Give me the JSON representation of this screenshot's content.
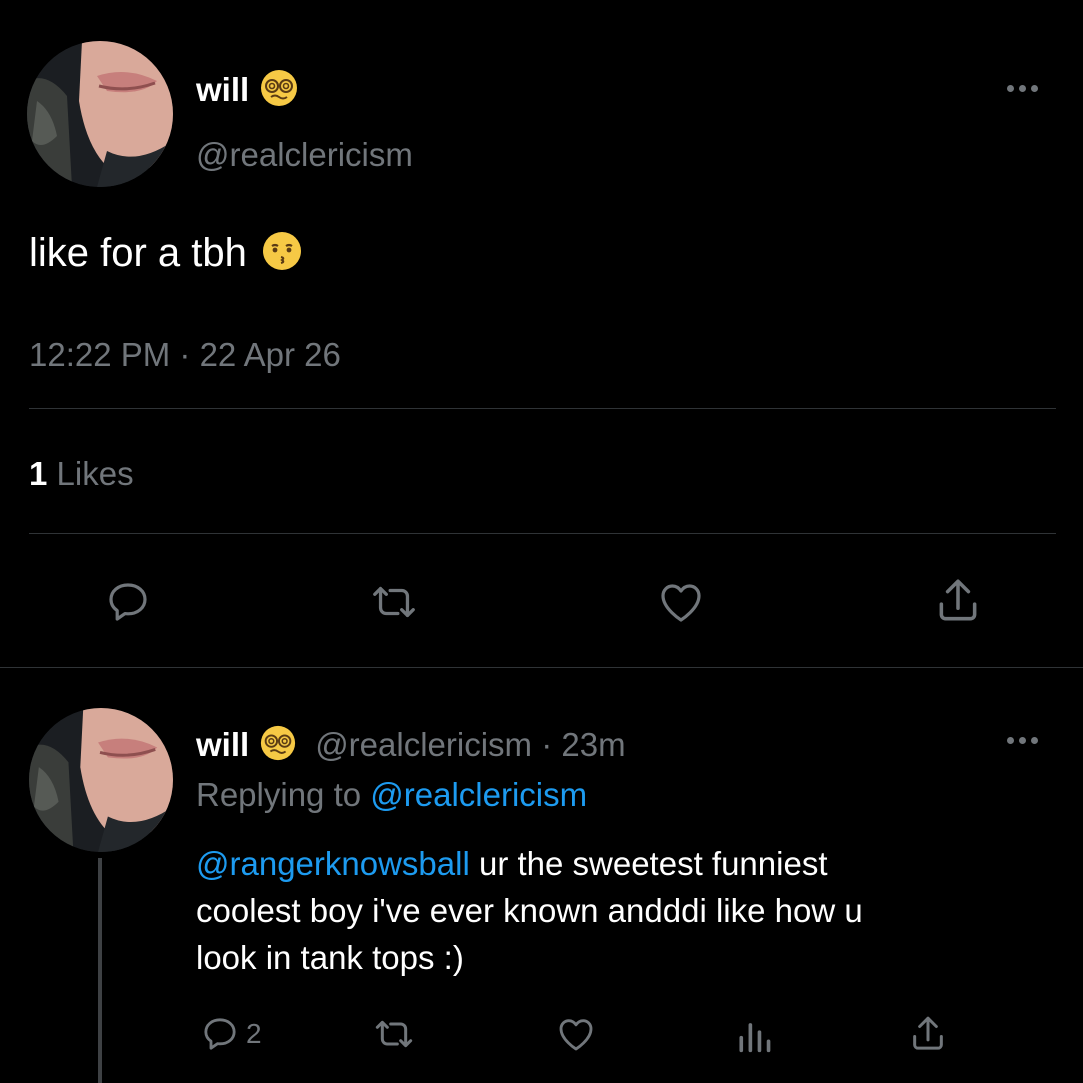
{
  "tweet": {
    "display_name": "will",
    "name_emoji": "dizzy-face-emoji",
    "handle": "@realclericism",
    "text": "like for a tbh",
    "text_emoji": "kissing-face-emoji",
    "timestamp": "12:22 PM · 22 Apr 26",
    "likes_count": "1",
    "likes_label": "Likes",
    "actions": [
      "reply-icon",
      "retweet-icon",
      "like-icon",
      "share-icon"
    ]
  },
  "reply": {
    "display_name": "will",
    "name_emoji": "dizzy-face-emoji",
    "handle_time": "@realclericism · 23m",
    "replying_to_prefix": "Replying to ",
    "replying_to_handle": "@realclericism",
    "mention": "@rangerknowsball",
    "text_line1": " ur the sweetest funniest",
    "text_line2": "coolest boy i've ever known andddi like how u",
    "text_line3": "look in tank tops :)",
    "reply_count": "2",
    "actions": [
      "reply-icon",
      "retweet-icon",
      "like-icon",
      "analytics-icon",
      "share-icon"
    ]
  },
  "colors": {
    "background": "#000000",
    "text": "#e7e9ea",
    "muted": "#71767b",
    "link": "#1d9bf0",
    "divider": "#2f3336"
  }
}
